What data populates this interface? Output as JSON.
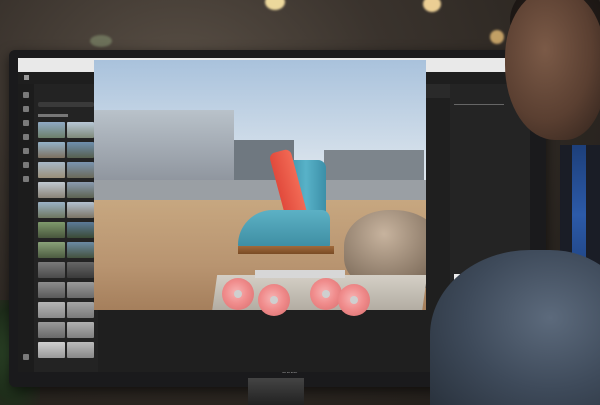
{
  "scene": {
    "description_colors": {
      "wall": "#3a332d",
      "accent": "#f08c8c"
    }
  },
  "app": {
    "window_title": "",
    "menubar_items": "",
    "tabs": [
      "",
      ""
    ]
  },
  "canvas": {
    "toolbar_left": "",
    "toolbar_center": ""
  },
  "rightpanel": {
    "sections": [
      "",
      ""
    ]
  },
  "monitor": {
    "brand": "DELL"
  }
}
